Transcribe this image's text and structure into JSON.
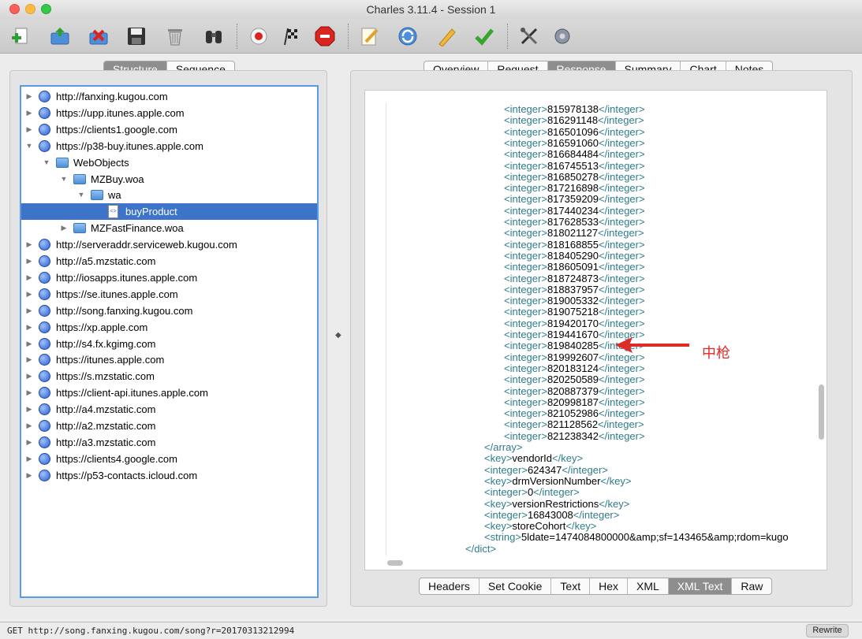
{
  "window": {
    "title": "Charles 3.11.4 - Session 1"
  },
  "toolbar": {
    "icons": [
      "new-session-icon",
      "open-session-icon",
      "close-session-icon",
      "save-icon",
      "clear-trash-icon",
      "find-binoculars-icon",
      "record-icon",
      "throttle-flag-icon",
      "breakpoints-stop-icon",
      "compose-edit-icon",
      "repeat-icon",
      "edit-pencil-icon",
      "validate-checkmark-icon",
      "tools-icon",
      "settings-gear-icon"
    ]
  },
  "left_tabs": [
    "Structure",
    "Sequence"
  ],
  "left_active": "Structure",
  "tree": [
    {
      "label": "http://fanxing.kugou.com",
      "depth": 0,
      "kind": "globe",
      "expanded": false
    },
    {
      "label": "https://upp.itunes.apple.com",
      "depth": 0,
      "kind": "globe",
      "expanded": false
    },
    {
      "label": "https://clients1.google.com",
      "depth": 0,
      "kind": "globe",
      "expanded": false
    },
    {
      "label": "https://p38-buy.itunes.apple.com",
      "depth": 0,
      "kind": "globe",
      "expanded": true
    },
    {
      "label": "WebObjects",
      "depth": 1,
      "kind": "folder",
      "expanded": true
    },
    {
      "label": "MZBuy.woa",
      "depth": 2,
      "kind": "folder",
      "expanded": true
    },
    {
      "label": "wa",
      "depth": 3,
      "kind": "folder",
      "expanded": true
    },
    {
      "label": "buyProduct",
      "depth": 4,
      "kind": "doc",
      "selected": true
    },
    {
      "label": "MZFastFinance.woa",
      "depth": 2,
      "kind": "folder",
      "expanded": false
    },
    {
      "label": "http://serveraddr.serviceweb.kugou.com",
      "depth": 0,
      "kind": "globe",
      "expanded": false
    },
    {
      "label": "http://a5.mzstatic.com",
      "depth": 0,
      "kind": "globe",
      "expanded": false
    },
    {
      "label": "http://iosapps.itunes.apple.com",
      "depth": 0,
      "kind": "globe",
      "expanded": false
    },
    {
      "label": "https://se.itunes.apple.com",
      "depth": 0,
      "kind": "globe",
      "expanded": false
    },
    {
      "label": "http://song.fanxing.kugou.com",
      "depth": 0,
      "kind": "globe",
      "expanded": false
    },
    {
      "label": "https://xp.apple.com",
      "depth": 0,
      "kind": "globe",
      "expanded": false
    },
    {
      "label": "http://s4.fx.kgimg.com",
      "depth": 0,
      "kind": "globe",
      "expanded": false
    },
    {
      "label": "https://itunes.apple.com",
      "depth": 0,
      "kind": "globe",
      "expanded": false
    },
    {
      "label": "https://s.mzstatic.com",
      "depth": 0,
      "kind": "globe",
      "expanded": false
    },
    {
      "label": "https://client-api.itunes.apple.com",
      "depth": 0,
      "kind": "globe",
      "expanded": false
    },
    {
      "label": "http://a4.mzstatic.com",
      "depth": 0,
      "kind": "globe",
      "expanded": false
    },
    {
      "label": "http://a2.mzstatic.com",
      "depth": 0,
      "kind": "globe",
      "expanded": false
    },
    {
      "label": "http://a3.mzstatic.com",
      "depth": 0,
      "kind": "globe",
      "expanded": false
    },
    {
      "label": "https://clients4.google.com",
      "depth": 0,
      "kind": "globe",
      "expanded": false
    },
    {
      "label": "https://p53-contacts.icloud.com",
      "depth": 0,
      "kind": "globe",
      "expanded": false
    }
  ],
  "right_tabs": [
    "Overview",
    "Request",
    "Response",
    "Summary",
    "Chart",
    "Notes"
  ],
  "right_active": "Response",
  "xml": {
    "integers": [
      "815978138",
      "816291148",
      "816501096",
      "816591060",
      "816684484",
      "816745513",
      "816850278",
      "817216898",
      "817359209",
      "817440234",
      "817628533",
      "818021127",
      "818168855",
      "818405290",
      "818605091",
      "818724873",
      "818837957",
      "819005332",
      "819075218",
      "819420170",
      "819441670",
      "819840285",
      "819992607",
      "820183124",
      "820250589",
      "820887379",
      "820998187",
      "821052986",
      "821128562",
      "821238342"
    ],
    "tail": [
      {
        "indent": 1,
        "parts": [
          [
            "t",
            "</"
          ],
          [
            "t",
            "array"
          ],
          [
            "t",
            ">"
          ]
        ]
      },
      {
        "indent": 1,
        "parts": [
          [
            "t",
            "<"
          ],
          [
            "t",
            "key"
          ],
          [
            "t",
            ">"
          ],
          [
            "v",
            "vendorId"
          ],
          [
            "t",
            "</"
          ],
          [
            "t",
            "key"
          ],
          [
            "t",
            ">"
          ]
        ]
      },
      {
        "indent": 1,
        "parts": [
          [
            "t",
            "<"
          ],
          [
            "t",
            "integer"
          ],
          [
            "t",
            ">"
          ],
          [
            "v",
            "624347"
          ],
          [
            "t",
            "</"
          ],
          [
            "t",
            "integer"
          ],
          [
            "t",
            ">"
          ]
        ]
      },
      {
        "indent": 1,
        "parts": [
          [
            "t",
            "<"
          ],
          [
            "t",
            "key"
          ],
          [
            "t",
            ">"
          ],
          [
            "v",
            "drmVersionNumber"
          ],
          [
            "t",
            "</"
          ],
          [
            "t",
            "key"
          ],
          [
            "t",
            ">"
          ]
        ]
      },
      {
        "indent": 1,
        "parts": [
          [
            "t",
            "<"
          ],
          [
            "t",
            "integer"
          ],
          [
            "t",
            ">"
          ],
          [
            "v",
            "0"
          ],
          [
            "t",
            "</"
          ],
          [
            "t",
            "integer"
          ],
          [
            "t",
            ">"
          ]
        ]
      },
      {
        "indent": 1,
        "parts": [
          [
            "t",
            "<"
          ],
          [
            "t",
            "key"
          ],
          [
            "t",
            ">"
          ],
          [
            "v",
            "versionRestrictions"
          ],
          [
            "t",
            "</"
          ],
          [
            "t",
            "key"
          ],
          [
            "t",
            ">"
          ]
        ]
      },
      {
        "indent": 1,
        "parts": [
          [
            "t",
            "<"
          ],
          [
            "t",
            "integer"
          ],
          [
            "t",
            ">"
          ],
          [
            "v",
            "16843008"
          ],
          [
            "t",
            "</"
          ],
          [
            "t",
            "integer"
          ],
          [
            "t",
            ">"
          ]
        ]
      },
      {
        "indent": 1,
        "parts": [
          [
            "t",
            "<"
          ],
          [
            "t",
            "key"
          ],
          [
            "t",
            ">"
          ],
          [
            "v",
            "storeCohort"
          ],
          [
            "t",
            "</"
          ],
          [
            "t",
            "key"
          ],
          [
            "t",
            ">"
          ]
        ]
      },
      {
        "indent": 1,
        "parts": [
          [
            "t",
            "<"
          ],
          [
            "t",
            "string"
          ],
          [
            "t",
            ">"
          ],
          [
            "v",
            "5ldate=1474084800000&amp;sf=143465&amp;rdom=kugo"
          ]
        ]
      },
      {
        "indent": 0,
        "parts": [
          [
            "t",
            "</"
          ],
          [
            "t",
            "dict"
          ],
          [
            "t",
            ">"
          ]
        ]
      }
    ]
  },
  "annotation": {
    "label": "中枪",
    "color": "#e02a26"
  },
  "bottom_tabs": [
    "Headers",
    "Set Cookie",
    "Text",
    "Hex",
    "XML",
    "XML Text",
    "Raw"
  ],
  "bottom_active": "XML Text",
  "status": {
    "text": "GET http://song.fanxing.kugou.com/song?r=20170313212994",
    "rewrite": "Rewrite"
  }
}
